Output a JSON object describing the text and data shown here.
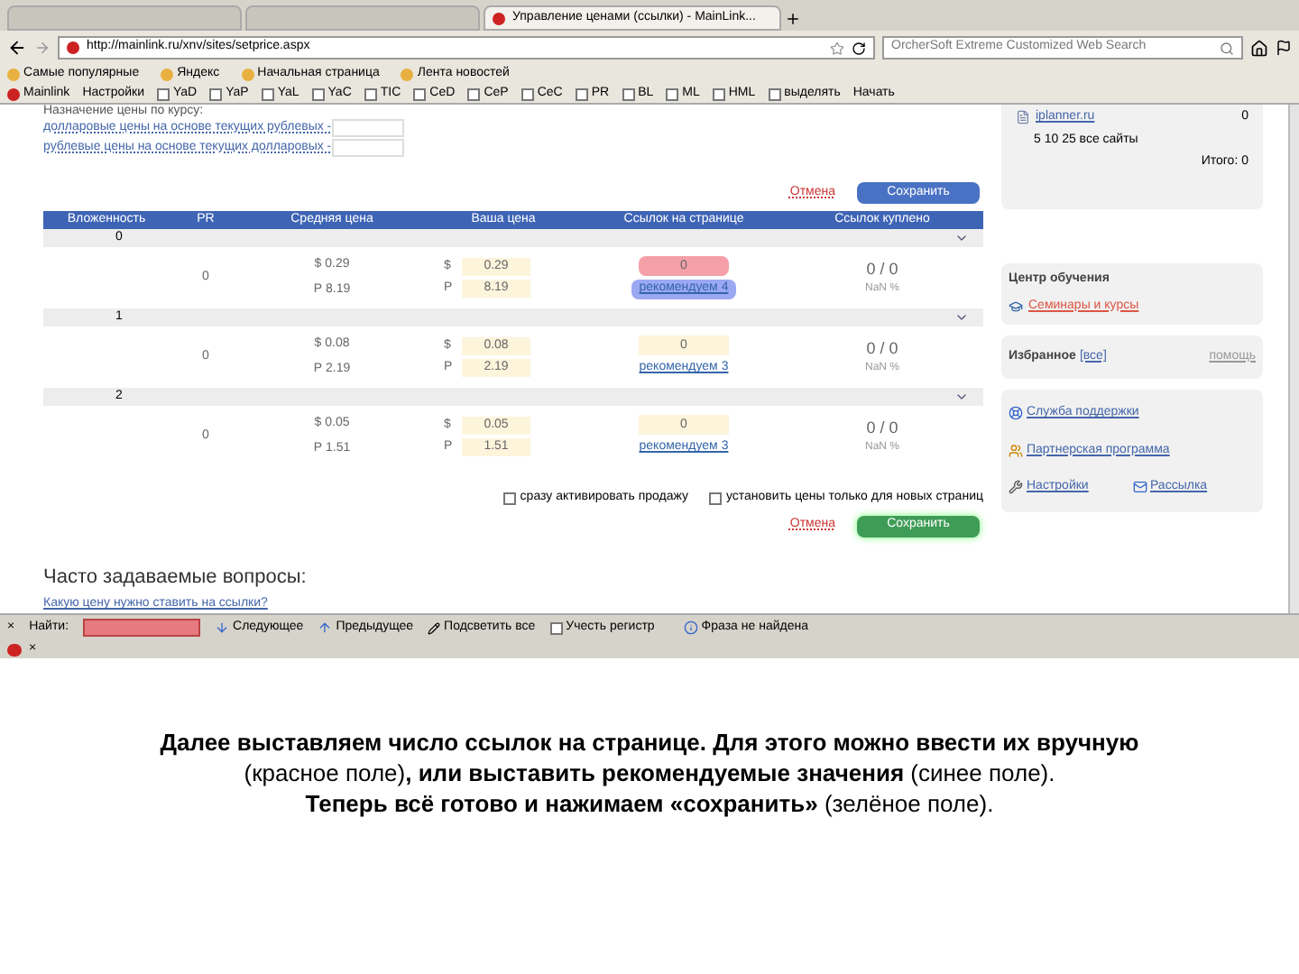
{
  "tabs": [
    {
      "selected": false
    },
    {
      "selected": false
    },
    {
      "label": "Управление ценами (ссылки) - MainLink...",
      "selected": true
    }
  ],
  "address_bar": {
    "url": "http://mainlink.ru/xnv/sites/setprice.aspx"
  },
  "search_field": {
    "placeholder": "OrcherSoft Extreme Customized Web Search"
  },
  "bookmarks": [
    "Самые популярные",
    "Яндекс",
    "Начальная страница",
    "Лента новостей"
  ],
  "toolbar": {
    "brand": "Mainlink",
    "settings": "Настройки",
    "checks": [
      {
        "label": "YaD",
        "checked": false
      },
      {
        "label": "YaP",
        "checked": false
      },
      {
        "label": "YaL",
        "checked": false
      },
      {
        "label": "YaC",
        "checked": false
      },
      {
        "label": "TIC",
        "checked": false
      },
      {
        "label": "CeD",
        "checked": false
      },
      {
        "label": "CeP",
        "checked": false
      },
      {
        "label": "CeC",
        "checked": false
      },
      {
        "label": "PR",
        "checked": false
      },
      {
        "label": "BL",
        "checked": false
      },
      {
        "label": "ML",
        "checked": false
      },
      {
        "label": "HML",
        "checked": false
      },
      {
        "label": "выделять",
        "checked": false
      }
    ],
    "start": "Начать"
  },
  "rate_section": {
    "title": "Назначение цены по курсу:",
    "links": [
      "долларовые цены на основе текущих рублевых -",
      "рублевые цены на основе текущих долларовых -"
    ]
  },
  "top_actions": {
    "cancel": "Отмена",
    "save": "Сохранить",
    "save_highlighted": false
  },
  "table": {
    "columns": [
      "Вложенность",
      "PR",
      "Средняя цена",
      "Ваша цена",
      "Ссылок на странице",
      "Ссылок куплено"
    ],
    "groups": [
      {
        "level": "0",
        "pr": "0",
        "avg_usd": "$ 0.29",
        "avg_rub": "Р 8.19",
        "usd_sign": "$",
        "price_usd": "0.29",
        "rub_sign": "Р",
        "price_rub": "8.19",
        "links": "0",
        "links_highlighted": true,
        "recommend": "рекомендуем 4",
        "recommend_highlighted": true,
        "bought": "0 / 0",
        "bought_pct": "NaN %"
      },
      {
        "level": "1",
        "pr": "0",
        "avg_usd": "$ 0.08",
        "avg_rub": "Р 2.19",
        "usd_sign": "$",
        "price_usd": "0.08",
        "rub_sign": "Р",
        "price_rub": "2.19",
        "links": "0",
        "links_highlighted": false,
        "recommend": "рекомендуем 3",
        "recommend_highlighted": false,
        "bought": "0 / 0",
        "bought_pct": "NaN %"
      },
      {
        "level": "2",
        "pr": "0",
        "avg_usd": "$ 0.05",
        "avg_rub": "Р 1.51",
        "usd_sign": "$",
        "price_usd": "0.05",
        "rub_sign": "Р",
        "price_rub": "1.51",
        "links": "0",
        "links_highlighted": false,
        "recommend": "рекомендуем 3",
        "recommend_highlighted": false,
        "bought": "0 / 0",
        "bought_pct": "NaN %"
      }
    ]
  },
  "options": [
    {
      "label": "сразу активировать продажу",
      "checked": false
    },
    {
      "label": "установить цены только для новых страниц",
      "checked": false
    }
  ],
  "bottom_actions": {
    "cancel": "Отмена",
    "save": "Сохранить",
    "save_highlighted": true
  },
  "faq": {
    "title": "Часто задаваемые вопросы:",
    "link": "Какую цену нужно ставить на ссылки?"
  },
  "sidebar": {
    "site": "iplanner.ru",
    "site_count": "0",
    "filter": "5 10 25 все сайты",
    "total": "Итого: 0",
    "learning": {
      "title": "Центр обучения",
      "link": "Семинары и курсы"
    },
    "favorites": {
      "title": "Избранное",
      "all": "[все]",
      "help": "помощь"
    },
    "links": [
      {
        "kind": "support",
        "label": "Служба поддержки"
      },
      {
        "kind": "partner",
        "label": "Партнерская программа"
      },
      {
        "kind": "settings",
        "label": "Настройки"
      },
      {
        "kind": "mail",
        "label": "Рассылка"
      }
    ]
  },
  "find_bar": {
    "close": "×",
    "label": "Найти:",
    "next": "Следующее",
    "prev": "Предыдущее",
    "highlight_all": "Подсветить все",
    "match_case": {
      "label": "Учесть регистр",
      "checked": false
    },
    "status": "Фраза не найдена"
  },
  "status_bar": {
    "close": "×"
  },
  "caption": [
    "**Далее выставляем число ссылок на странице. Для этого можно ввести их вручную** (красное поле)**, или выставить рекомендуемые значения** (синее поле).",
    "**Теперь всё готово и нажимаем «сохранить»** (зелёное поле)."
  ]
}
